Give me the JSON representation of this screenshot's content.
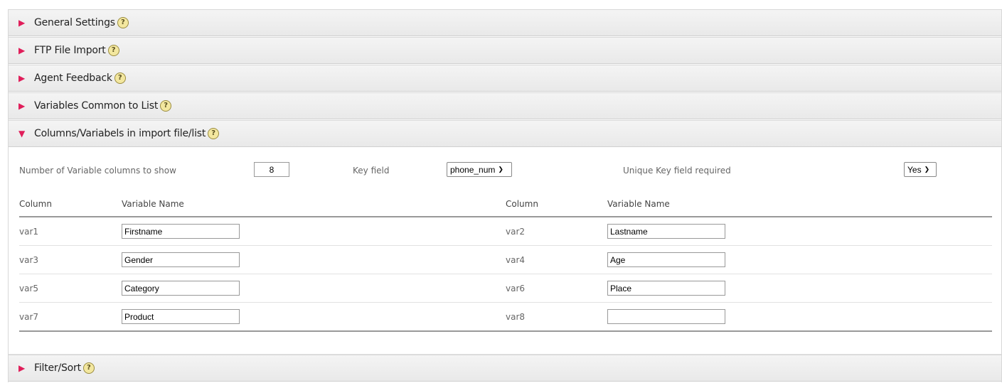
{
  "sections": [
    {
      "title": "General Settings",
      "expanded": false
    },
    {
      "title": "FTP File Import",
      "expanded": false
    },
    {
      "title": "Agent Feedback",
      "expanded": false
    },
    {
      "title": "Variables Common to List",
      "expanded": false
    },
    {
      "title": "Columns/Variabels in import file/list",
      "expanded": true
    },
    {
      "title": "Filter/Sort",
      "expanded": false
    }
  ],
  "help_glyph": "?",
  "icons": {
    "collapsed": "triangle-right-icon",
    "expanded": "triangle-down-icon",
    "help": "help-icon"
  },
  "accent_color": "#e01e5a",
  "columns_panel": {
    "num_columns_label": "Number of Variable columns to show",
    "num_columns_value": "8",
    "key_field_label": "Key field",
    "key_field_value": "phone_num",
    "unique_key_label": "Unique Key field required",
    "unique_key_value": "Yes",
    "headers": {
      "column": "Column",
      "variable_name": "Variable Name"
    },
    "rows": [
      {
        "left_col": "var1",
        "left_name": "Firstname",
        "right_col": "var2",
        "right_name": "Lastname"
      },
      {
        "left_col": "var3",
        "left_name": "Gender",
        "right_col": "var4",
        "right_name": "Age"
      },
      {
        "left_col": "var5",
        "left_name": "Category",
        "right_col": "var6",
        "right_name": "Place"
      },
      {
        "left_col": "var7",
        "left_name": "Product",
        "right_col": "var8",
        "right_name": ""
      }
    ]
  }
}
